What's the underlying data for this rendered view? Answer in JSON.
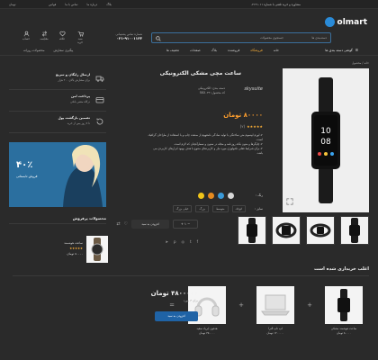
{
  "topbar": {
    "promo": "مشاوره و خرید تلفنی با شماره ۰۲۱۹۱۰۱۱",
    "links": [
      "بلاگ",
      "درباره ما",
      "تماس با ما",
      "قوانین"
    ],
    "currency": "تومان"
  },
  "header": {
    "logo": "olmart",
    "search_placeholder": "جستجوی محصولات",
    "search_category": "دسته‌بندی ها",
    "phone_label": "شماره تماس پشتیبانی",
    "phone": "۰۲۱-۹۱۰۰۱۱۲۳",
    "icons": [
      {
        "name": "user-icon",
        "label": "حساب"
      },
      {
        "name": "compare-icon",
        "label": "مقایسه"
      },
      {
        "name": "heart-icon",
        "label": "علاقه"
      },
      {
        "name": "cart-icon",
        "label": "سبد خرید"
      }
    ]
  },
  "nav": {
    "categories": "گوشی دسته بندی ها",
    "menu": [
      "خانه",
      "فروشگاه",
      "فروشنده",
      "بلاگ",
      "صفحات",
      "تخفیف ها"
    ],
    "active_index": 1,
    "extra": [
      "پیگیری سفارش",
      "محصولات روزانه"
    ]
  },
  "breadcrumb": "خانه / محصول",
  "product": {
    "title": "ساعت مچی مشکی الکترونیکی",
    "brand": "skysuite",
    "meta_lines": [
      "دسته بندی: الکترونیکی",
      "کد محصول: SKU۰۲۳"
    ],
    "price": "۸۰۰۰۰ تومان",
    "rating": "★★★★★",
    "rating_count": "(۲)",
    "bullets": [
      "لورم ایپسوم متن ساختگی با تولید سادگی نامفهوم از صنعت چاپ و با استفاده از طراحان گرافیک است.",
      "چاپگرها و متون بلکه روزنامه و مجله در ستون و سطرآنچنان که لازم است.",
      "برای شرایط فعلی تکنولوژی مورد نیاز و کاربردهای متنوع با هدف بهبود ابزارهای کاربردی می باشد."
    ],
    "color_label": "رنگ :",
    "colors": [
      "#d8d8d8",
      "#3a9ad9",
      "#e58a1f",
      "#f0c419"
    ],
    "size_label": "سایز :",
    "sizes": [
      "کوچک",
      "متوسط",
      "بزرگ",
      "خیلی بزرگ"
    ],
    "qty": "۱",
    "add_to_cart": "افزودن به سبد"
  },
  "features": [
    {
      "icon": "truck-icon",
      "title": "ارسال رایگان و سریع",
      "desc": "برای سفارش بالای ۲۰۰ هزار"
    },
    {
      "icon": "card-icon",
      "title": "پرداخت امن",
      "desc": "درگاه معتبر بانکی"
    },
    {
      "icon": "return-icon",
      "title": "تضمین بازگشت پول",
      "desc": "تا ۷ روز پس از خرید"
    }
  ],
  "banner": {
    "percent": "۴۰٪",
    "subtitle": "فروش تابستانی"
  },
  "best_sellers": {
    "title": "محصولات پرفروش",
    "item": {
      "name": "ساعت هوشمند",
      "stars": "★★★★★",
      "price": "۸۰۰۰۰ تومان"
    }
  },
  "bundle": {
    "title": "اغلب خریداری شده است",
    "items": [
      {
        "name": "ساعت هوشمند مشکی",
        "price": "۸۰۰۰۰ تومان"
      },
      {
        "name": "لپ تاپ الترا",
        "price": "۱۲۰۰۰۰۰ تومان"
      },
      {
        "name": "هدفون ایرپاد سفید",
        "price": "۴۵۰۰۰۰ تومان"
      }
    ],
    "total": "۴۸۰۰۰۰۰ تومان",
    "count": "برای ۳ مورد",
    "button": "افزودن به سبد"
  }
}
